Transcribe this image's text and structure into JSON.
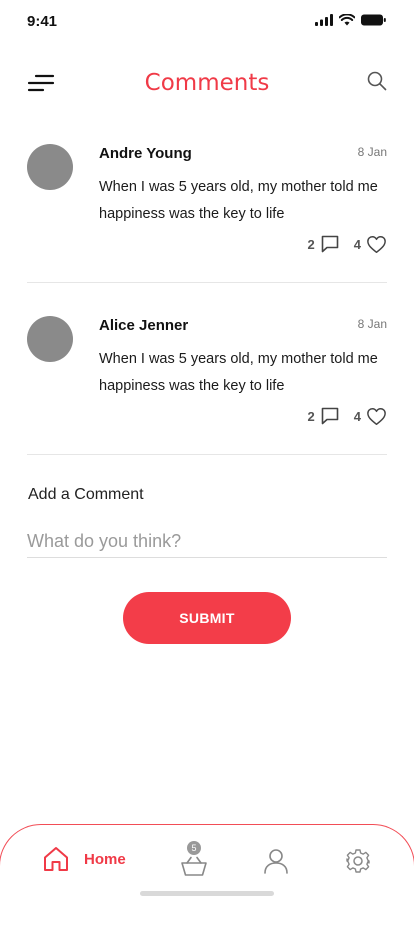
{
  "status_bar": {
    "time": "9:41"
  },
  "header": {
    "title": "Comments",
    "menu_icon": "menu-icon",
    "search_icon": "search-icon"
  },
  "comments": [
    {
      "author": "Andre Young",
      "date": "8 Jan",
      "text": "When I was 5 years old, my mother told me happiness was the key to life",
      "reply_count": "2",
      "like_count": "4"
    },
    {
      "author": "Alice Jenner",
      "date": "8 Jan",
      "text": "When I was 5 years old, my mother told me happiness was the key to life",
      "reply_count": "2",
      "like_count": "4"
    }
  ],
  "add_comment": {
    "label": "Add a Comment",
    "placeholder": "What do you think?",
    "value": "",
    "submit_label": "SUBMIT"
  },
  "bottom_nav": {
    "home_label": "Home",
    "cart_badge": "5"
  },
  "colors": {
    "accent": "#f03a47",
    "avatar": "#8a8a8a",
    "divider": "#e6e6e6"
  }
}
